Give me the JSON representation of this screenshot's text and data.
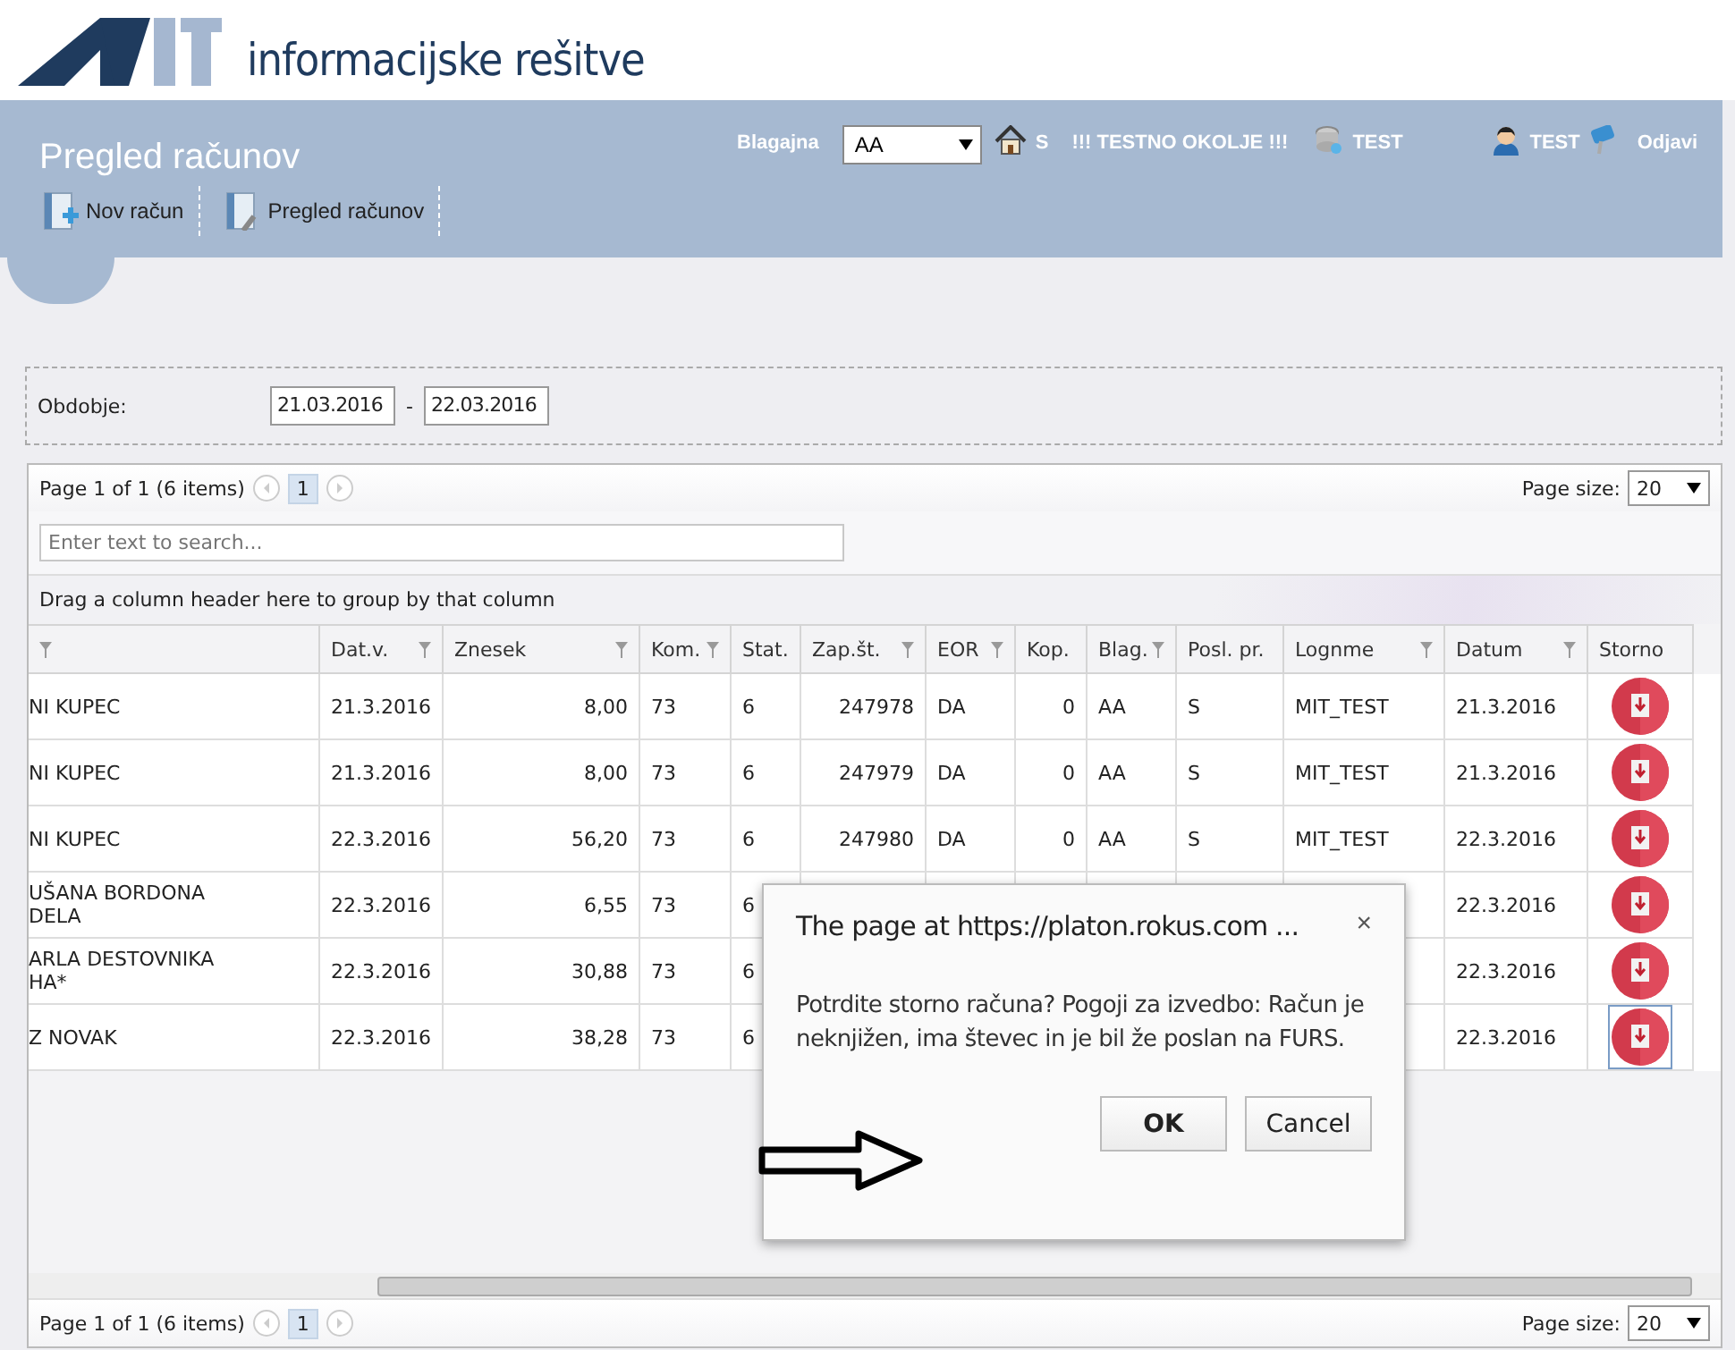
{
  "logo": {
    "text": "informacijske rešitve"
  },
  "header": {
    "title": "Pregled računov",
    "toolbar": [
      {
        "label": "Nov račun",
        "kind": "new"
      },
      {
        "label": "Pregled računov",
        "kind": "view"
      }
    ],
    "blagajna_label": "Blagajna",
    "blagajna_value": "AA",
    "location": "S",
    "environment": "!!! TESTNO OKOLJE !!!",
    "database": "TEST",
    "user": "TEST",
    "logout": "Odjavi"
  },
  "filter": {
    "label": "Obdobje:",
    "from": "21.03.2016",
    "separator": "-",
    "to": "22.03.2016"
  },
  "pager_top": {
    "summary": "Page 1 of 1 (6 items)",
    "pages": [
      {
        "label": "1",
        "selected": true
      }
    ],
    "size_label": "Page size:",
    "size": "20"
  },
  "search": {
    "placeholder": "Enter text to search..."
  },
  "group_panel": "Drag a column header here to group by that column",
  "table": {
    "columns": [
      {
        "filter": true
      },
      {
        "label": "Dat.v.",
        "filter": true
      },
      {
        "label": "Znesek",
        "filter": true
      },
      {
        "label": "Kom.",
        "filter": true
      },
      {
        "label": "Stat.",
        "filter": false
      },
      {
        "label": "Zap.št.",
        "filter": true
      },
      {
        "label": "EOR",
        "filter": true
      },
      {
        "label": "Kop.",
        "filter": false
      },
      {
        "label": "Blag.",
        "filter": true
      },
      {
        "label": "Posl. pr.",
        "filter": false
      },
      {
        "label": "Lognme",
        "filter": true
      },
      {
        "label": "Datum",
        "filter": true
      },
      {
        "label": "Storno",
        "filter": false
      }
    ],
    "rows": [
      {
        "cells": [
          "NI KUPEC",
          "21.3.2016",
          "8,00",
          "73",
          "6",
          "247978",
          "DA",
          "0",
          "AA",
          "S",
          "MIT_TEST",
          "21.3.2016"
        ],
        "focused": false
      },
      {
        "cells": [
          "NI KUPEC",
          "21.3.2016",
          "8,00",
          "73",
          "6",
          "247979",
          "DA",
          "0",
          "AA",
          "S",
          "MIT_TEST",
          "21.3.2016"
        ],
        "focused": false
      },
      {
        "cells": [
          "NI KUPEC",
          "22.3.2016",
          "56,20",
          "73",
          "6",
          "247980",
          "DA",
          "0",
          "AA",
          "S",
          "MIT_TEST",
          "22.3.2016"
        ],
        "focused": false
      },
      {
        "cells": [
          "UŠANA BORDONA\nDELA",
          "22.3.2016",
          "6,55",
          "73",
          "6",
          null,
          null,
          null,
          null,
          null,
          null,
          "22.3.2016"
        ],
        "focused": false
      },
      {
        "cells": [
          "ARLA DESTOVNIKA\nHA*",
          "22.3.2016",
          "30,88",
          "73",
          "6",
          null,
          null,
          null,
          null,
          null,
          null,
          "22.3.2016"
        ],
        "focused": false
      },
      {
        "cells": [
          "Z NOVAK",
          "22.3.2016",
          "38,28",
          "73",
          "6",
          null,
          null,
          null,
          null,
          null,
          null,
          "22.3.2016"
        ],
        "focused": true
      }
    ]
  },
  "pager_bottom": {
    "summary": "Page 1 of 1 (6 items)",
    "pages": [
      {
        "label": "1",
        "selected": true
      }
    ],
    "size_label": "Page size:",
    "size": "20"
  },
  "dialog": {
    "title": "The page at https://platon.rokus.com ...",
    "close": "×",
    "message": "Potrdite storno računa? Pogoji za izvedbo: Račun je neknjižen, ima števec in je bil že poslan na FURS.",
    "ok": "OK",
    "cancel": "Cancel"
  }
}
